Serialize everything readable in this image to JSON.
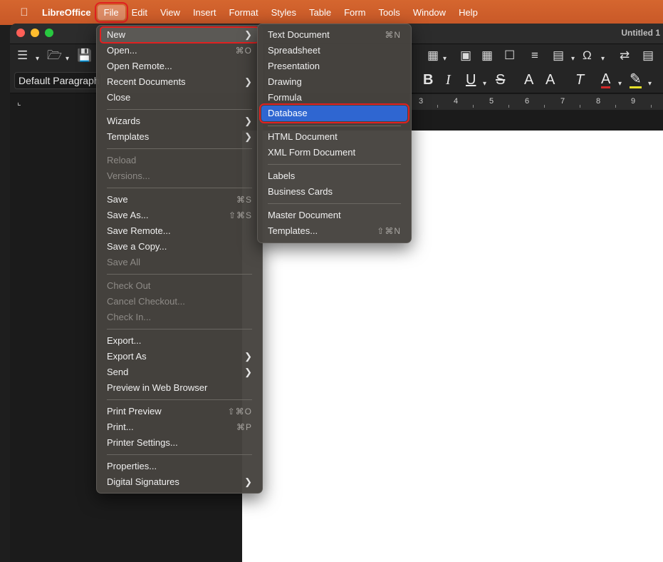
{
  "menubar": {
    "apple_icon": "apple-logo-icon",
    "app_name": "LibreOffice",
    "items": [
      "File",
      "Edit",
      "View",
      "Insert",
      "Format",
      "Styles",
      "Table",
      "Form",
      "Tools",
      "Window",
      "Help"
    ]
  },
  "window": {
    "title": "Untitled 1",
    "paragraph_style": "Default Paragraph Style",
    "ruler_numbers": [
      "3",
      "4",
      "5",
      "6",
      "7",
      "8",
      "9"
    ]
  },
  "file_menu": {
    "new": "New",
    "open": "Open...",
    "open_sc": "⌘O",
    "open_remote": "Open Remote...",
    "recent": "Recent Documents",
    "close": "Close",
    "wizards": "Wizards",
    "templates": "Templates",
    "reload": "Reload",
    "versions": "Versions...",
    "save": "Save",
    "save_sc": "⌘S",
    "save_as": "Save As...",
    "save_as_sc": "⇧⌘S",
    "save_remote": "Save Remote...",
    "save_copy": "Save a Copy...",
    "save_all": "Save All",
    "check_out": "Check Out",
    "cancel_checkout": "Cancel Checkout...",
    "check_in": "Check In...",
    "export": "Export...",
    "export_as": "Export As",
    "send": "Send",
    "preview_web": "Preview in Web Browser",
    "print_preview": "Print Preview",
    "print_preview_sc": "⇧⌘O",
    "print": "Print...",
    "print_sc": "⌘P",
    "printer_settings": "Printer Settings...",
    "properties": "Properties...",
    "digital_signatures": "Digital Signatures"
  },
  "new_submenu": {
    "text_document": "Text Document",
    "text_document_sc": "⌘N",
    "spreadsheet": "Spreadsheet",
    "presentation": "Presentation",
    "drawing": "Drawing",
    "formula": "Formula",
    "database": "Database",
    "html_document": "HTML Document",
    "xml_form": "XML Form Document",
    "labels": "Labels",
    "business_cards": "Business Cards",
    "master_document": "Master Document",
    "templates": "Templates...",
    "templates_sc": "⇧⌘N"
  },
  "colors": {
    "menubar": "#c85827",
    "selection": "#2f66d1",
    "annotation_box": "#e02020"
  }
}
